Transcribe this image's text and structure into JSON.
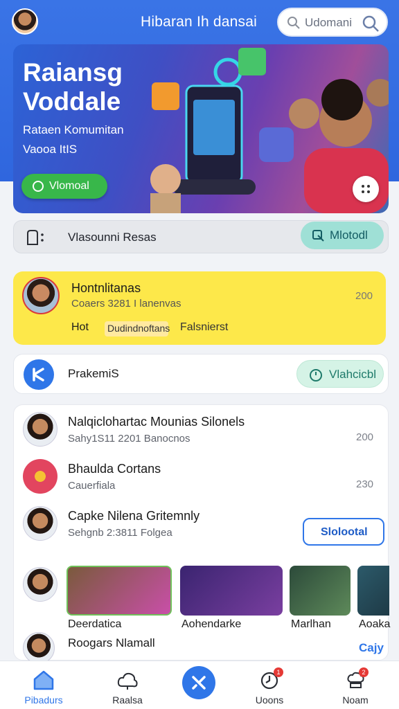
{
  "header": {
    "title": "Hibaran Ih dansai",
    "search_placeholder": "Udomani"
  },
  "hero": {
    "title": "Raiansg Voddale",
    "subtitle_1": "Rataen Komumitan",
    "subtitle_2": "Vaooa ItIS",
    "button_label": "Vlomoal"
  },
  "notice": {
    "text": "Vlasounni Resas",
    "button_label": "Mlotodl"
  },
  "featured": {
    "title": "Hontnlitanas",
    "subtitle": "Coaers 3281 I lanenvas",
    "count": "200",
    "hot_label": "Hot",
    "tag": "Dudindnoftans",
    "trailing_text": "Falsnierst"
  },
  "promo": {
    "text": "PrakemiS",
    "button_label": "Vlahcicbl"
  },
  "list": {
    "rows": [
      {
        "name": "Nalqiclohartac Mounias Silonels",
        "sub": "Sahy1S11 2201 Banocnos",
        "count": "200"
      },
      {
        "name": "Bhaulda Cortans",
        "sub": "Cauerfiala",
        "count": "230"
      },
      {
        "name": "Capke Nilena Gritemnly",
        "sub": "Sehgnb 2:3811 Folgea",
        "count": ""
      }
    ],
    "row_button_label": "Slolootal",
    "thumbnails": [
      {
        "label": "Deerdatica",
        "color": "#6fc25a"
      },
      {
        "label": "Aohendarke",
        "color": "#5a2f8f"
      },
      {
        "label": "Marlhan",
        "color": "#3d6b4a"
      },
      {
        "label": "Aoaka",
        "color": "#2c5a6a"
      }
    ],
    "last_row": {
      "name": "Roogars Nlamall"
    },
    "last_link": "Cajy"
  },
  "bottom_nav": {
    "items": [
      {
        "label": "Pibadurs",
        "icon": "home-icon"
      },
      {
        "label": "Raalsa",
        "icon": "cloud-icon"
      },
      {
        "label": "",
        "icon": "compose-icon"
      },
      {
        "label": "Uoons",
        "icon": "clock-icon",
        "badge": "1"
      },
      {
        "label": "Noam",
        "icon": "chef-icon",
        "badge": "2"
      }
    ]
  },
  "colors": {
    "primary": "#2f76e8",
    "header_blue": "#3a74e6",
    "featured_yellow": "#fde84a",
    "hero_green": "#38b74a"
  }
}
